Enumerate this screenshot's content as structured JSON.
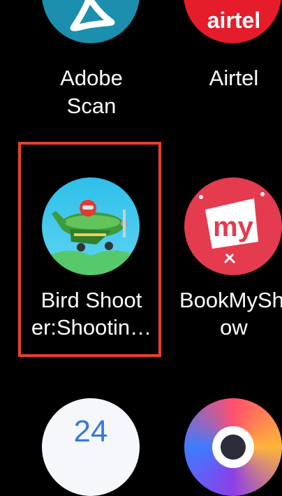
{
  "apps": [
    {
      "line1": "Adobe",
      "line2": "Scan",
      "icon": "adobe-scan-icon",
      "color": "#1d87a8"
    },
    {
      "line1": "Airtel",
      "line2": "",
      "icon": "airtel-icon",
      "color": "#e8192c",
      "icon_text": "airtel"
    },
    {
      "line1": "Bird Shoot",
      "line2": "er:Shootin…",
      "icon": "bird-shooter-icon",
      "color": "#33c1e8"
    },
    {
      "line1": "BookMySh",
      "line2": "ow",
      "icon": "bookmyshow-icon",
      "color": "#e43b4f",
      "icon_text": "my"
    },
    {
      "line1": "",
      "line2": "",
      "icon": "partial-app-icon",
      "color": "#ffffff"
    },
    {
      "line1": "",
      "line2": "",
      "icon": "partial-app-icon",
      "color": "#7b3fe4"
    }
  ],
  "highlight_color": "#e8402c"
}
